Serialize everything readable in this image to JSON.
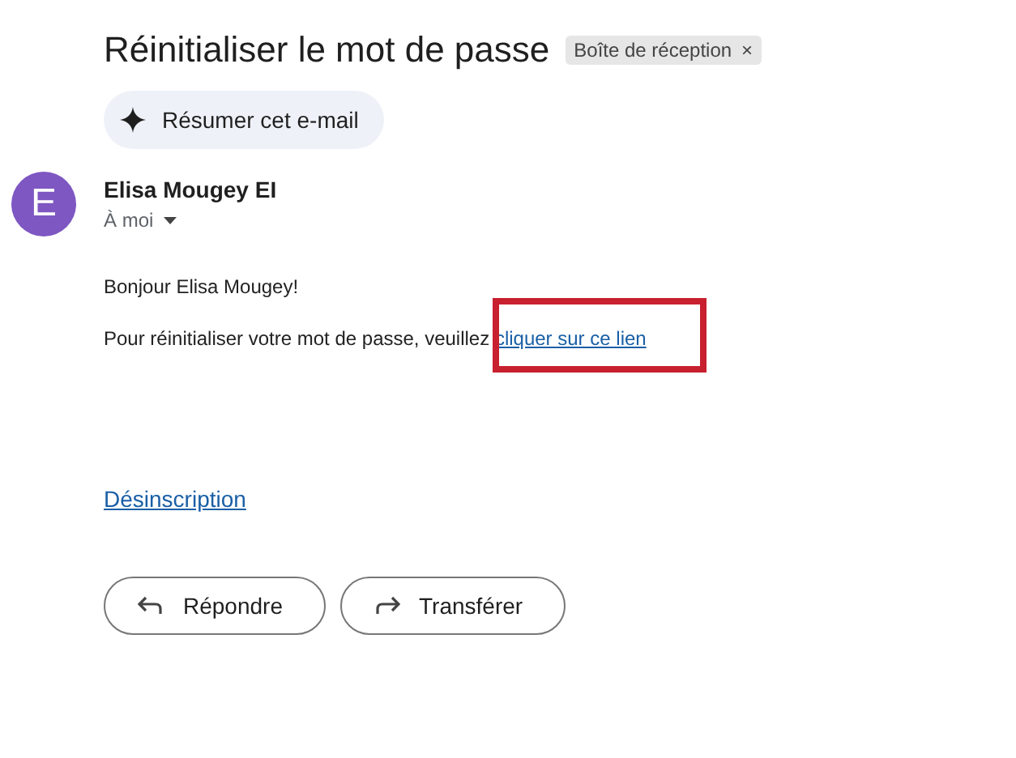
{
  "subject": "Réinitialiser le mot de passe",
  "label": {
    "text": "Boîte de réception",
    "remove": "×"
  },
  "summarize_button": "Résumer cet e-mail",
  "sender": {
    "initial": "E",
    "name": "Elisa Mougey EI",
    "recipient": "À moi"
  },
  "body": {
    "greeting": "Bonjour Elisa Mougey!",
    "sentence": "Pour réinitialiser votre mot de passe, veuillez",
    "link": {
      "text": "cliquer sur ce lien",
      "highlighted": true
    }
  },
  "unsubscribe": "Désinscription",
  "actions": [
    {
      "kind": "reply",
      "label": "Répondre"
    },
    {
      "kind": "forward",
      "label": "Transférer"
    }
  ]
}
